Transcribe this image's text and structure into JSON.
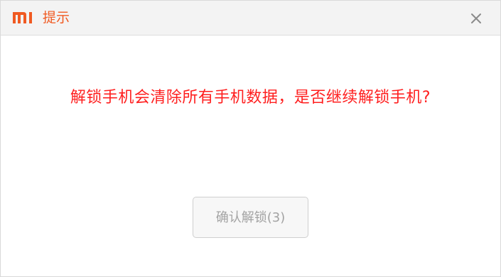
{
  "dialog": {
    "title": "提示",
    "logo_icon": "mi-logo",
    "close_icon": "close-icon",
    "brand_color": "#f05a22"
  },
  "message": {
    "text": "解锁手机会清除所有手机数据，是否继续解锁手机?",
    "color": "#ff1f1f"
  },
  "actions": {
    "confirm_label": "确认解锁(3)",
    "confirm_state": "disabled"
  }
}
